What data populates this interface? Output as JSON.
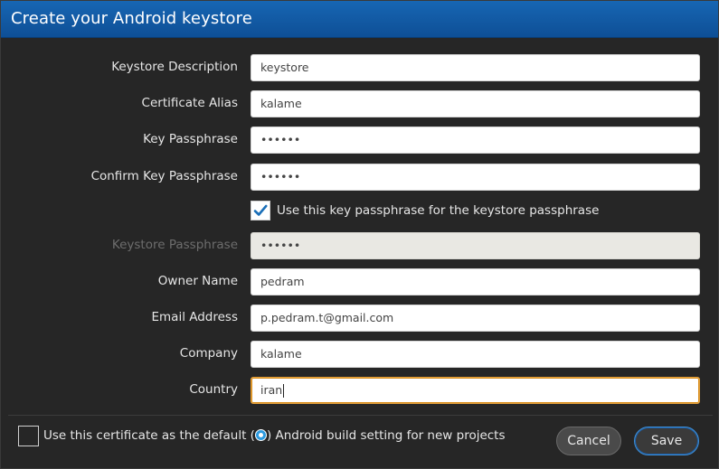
{
  "window": {
    "title": "Create your Android keystore"
  },
  "form": {
    "keystore_description": {
      "label": "Keystore Description",
      "value": "keystore"
    },
    "certificate_alias": {
      "label": "Certificate Alias",
      "value": "kalame"
    },
    "key_passphrase": {
      "label": "Key Passphrase",
      "value": "••••••"
    },
    "confirm_key_passphrase": {
      "label": "Confirm Key Passphrase",
      "value": "••••••"
    },
    "use_key_passphrase": {
      "label": "Use this key passphrase for the keystore passphrase",
      "checked": true
    },
    "keystore_passphrase": {
      "label": "Keystore Passphrase",
      "value": "••••••",
      "disabled": true
    },
    "owner_name": {
      "label": "Owner Name",
      "value": "pedram"
    },
    "email_address": {
      "label": "Email Address",
      "value": "p.pedram.t@gmail.com"
    },
    "company": {
      "label": "Company",
      "value": "kalame"
    },
    "country": {
      "label": "Country",
      "value": "iran"
    }
  },
  "footer": {
    "default_setting_prefix": "Use this certificate as the default (",
    "default_setting_suffix": ") Android build setting for new projects",
    "default_setting_checked": false,
    "cancel_label": "Cancel",
    "save_label": "Save"
  },
  "colors": {
    "title_bar": "#1766b3",
    "dialog_bg": "#262626",
    "checkbox_accent": "#1a6fb8",
    "focus_border": "#e6a23c",
    "info_badge": "#2d9be0"
  }
}
